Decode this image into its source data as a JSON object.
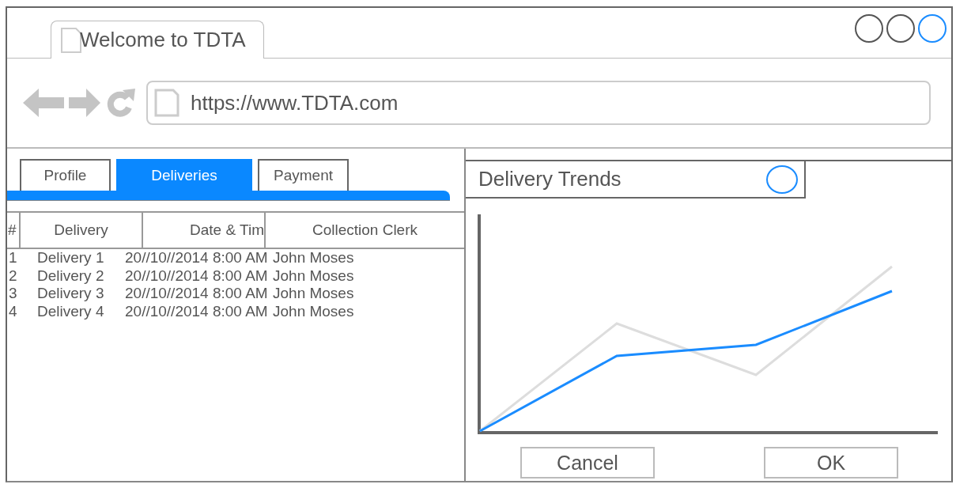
{
  "browser": {
    "tab_title": "Welcome to TDTA",
    "url": "https://www.TDTA.com",
    "window_controls": [
      {
        "color": "#555555"
      },
      {
        "color": "#555555"
      },
      {
        "color": "#1a8cff"
      }
    ]
  },
  "tabs": [
    {
      "label": "Profile",
      "selected": false
    },
    {
      "label": "Deliveries",
      "selected": true
    },
    {
      "label": "Payment",
      "selected": false
    }
  ],
  "table": {
    "columns": [
      "#",
      "Delivery",
      "Date & Tim",
      "Collection Clerk"
    ],
    "rows": [
      [
        "1",
        "Delivery 1",
        "20//10//2014 8:00 AM",
        "John Moses"
      ],
      [
        "2",
        "Delivery 2",
        "20//10//2014 8:00 AM",
        "John Moses"
      ],
      [
        "3",
        "Delivery 3",
        "20//10//2014 8:00 AM",
        "John Moses"
      ],
      [
        "4",
        "Delivery 4",
        "20//10//2014 8:00 AM",
        "John Moses"
      ]
    ]
  },
  "dialog": {
    "title": "Delivery Trends",
    "chart": {
      "kind": "picture"
    },
    "buttons": [
      "Cancel",
      "OK"
    ]
  }
}
